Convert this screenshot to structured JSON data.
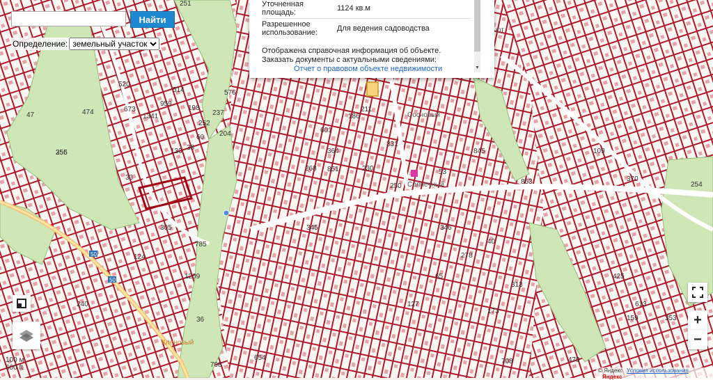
{
  "search": {
    "placeholder": "",
    "button_label": "Найти"
  },
  "definition": {
    "label": "Определение:",
    "selected": "земельный участок"
  },
  "popup": {
    "area_label": "Уточненная площадь:",
    "area_value": "1124 кв.м",
    "usage_label": "Разрешенное использование:",
    "usage_value": "Для ведения садоводства",
    "info_line1": "Отображена справочная информация об объекте.",
    "info_line2": "Заказать документы с актуальными сведениями:",
    "link_text": "Отчет о правовом объекте недвижимости"
  },
  "map": {
    "parcel_labels": [
      "256",
      "785",
      "654",
      "576",
      "708",
      "251",
      "47",
      "520",
      "474",
      "673",
      "1341",
      "959",
      "514",
      "198",
      "252",
      "237",
      "204",
      "130",
      "38",
      "60",
      "33",
      "305",
      "124",
      "1209",
      "36",
      "240",
      "345",
      "331",
      "250",
      "313",
      "254",
      "268",
      "186",
      "863",
      "851",
      "370",
      "425",
      "353",
      "159",
      "613",
      "479",
      "708",
      "601",
      "364",
      "845",
      "346",
      "278",
      "173",
      "230",
      "211",
      "127",
      "53",
      "65",
      "40",
      "109",
      "355"
    ],
    "road_labels": [
      "50",
      "50"
    ],
    "place_labels": [
      "Кленовый",
      "Солнечный",
      "Сосновый"
    ],
    "top_hint": "ют"
  },
  "controls": {
    "zoom_in": "+",
    "zoom_out": "−",
    "fullscreen_icon": "fullscreen-icon",
    "layers_icon": "layers-icon",
    "ruler_icon": "ruler-icon"
  },
  "scale": {
    "small": "100 м",
    "large": "600 ft"
  },
  "footer": {
    "copyright": "© Яндекс",
    "terms": "Условия использования",
    "logo": "Яндекс"
  },
  "colors": {
    "parcel_border": "#b0182a",
    "green": "#cfe6b6",
    "search_button": "#1e88d0",
    "road": "#ffffff"
  }
}
